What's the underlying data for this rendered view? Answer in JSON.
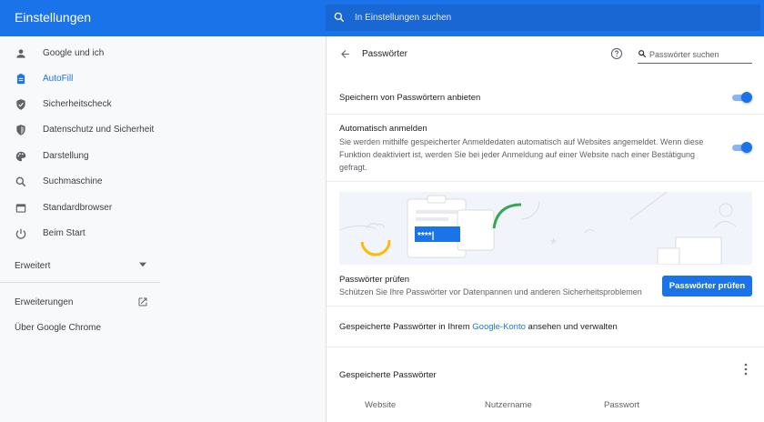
{
  "header": {
    "app_title": "Einstellungen",
    "search_placeholder": "In Einstellungen suchen"
  },
  "sidebar": {
    "items": [
      {
        "label": "Google und ich",
        "icon": "person-icon"
      },
      {
        "label": "AutoFill",
        "icon": "clipboard-icon",
        "active": true
      },
      {
        "label": "Sicherheitscheck",
        "icon": "shield-check-icon"
      },
      {
        "label": "Datenschutz und Sicherheit",
        "icon": "shield-icon"
      },
      {
        "label": "Darstellung",
        "icon": "palette-icon"
      },
      {
        "label": "Suchmaschine",
        "icon": "search-icon"
      },
      {
        "label": "Standardbrowser",
        "icon": "browser-icon"
      },
      {
        "label": "Beim Start",
        "icon": "power-icon"
      }
    ],
    "advanced_label": "Erweitert",
    "extensions_label": "Erweiterungen",
    "about_label": "Über Google Chrome"
  },
  "main": {
    "title": "Passwörter",
    "search_placeholder": "Passwörter suchen",
    "offer_save_label": "Speichern von Passwörtern anbieten",
    "auto_signin_label": "Automatisch anmelden",
    "auto_signin_desc": "Sie werden mithilfe gespeicherter Anmeldedaten automatisch auf Websites angemeldet. Wenn diese Funktion deaktiviert ist, werden Sie bei jeder Anmeldung auf einer Website nach einer Bestätigung gefragt.",
    "illustration_password": "****|",
    "check_title": "Passwörter prüfen",
    "check_desc": "Schützen Sie Ihre Passwörter vor Datenpannen und anderen Sicherheitsproblemen",
    "check_button": "Passwörter prüfen",
    "account_text_before": "Gespeicherte Passwörter in Ihrem ",
    "account_link": "Google-Konto",
    "account_text_after": " ansehen und verwalten",
    "saved_title": "Gespeicherte Passwörter",
    "columns": [
      "Website",
      "Nutzername",
      "Passwort"
    ]
  },
  "colors": {
    "accent": "#1a73e8",
    "topbar": "#1a73e8",
    "search_bg": "#1967d2"
  }
}
